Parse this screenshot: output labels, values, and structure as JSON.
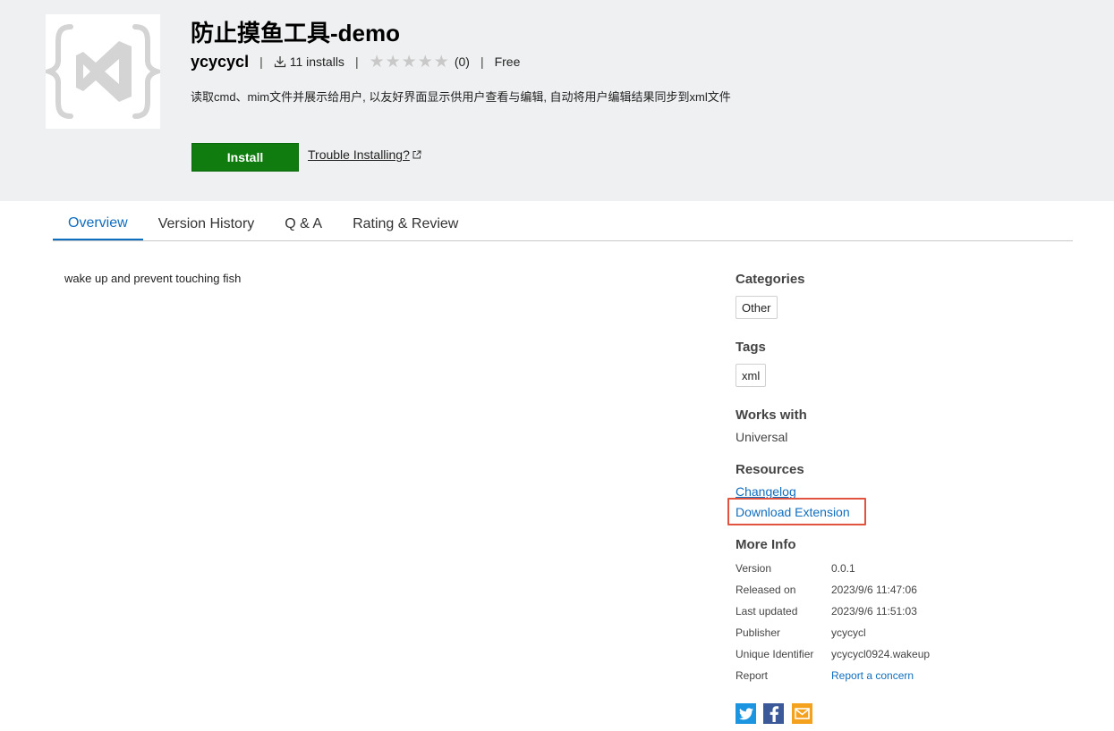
{
  "header": {
    "title": "防止摸鱼工具-demo",
    "publisher": "ycycycl",
    "installs": "11 installs",
    "rating_count": "(0)",
    "price": "Free",
    "description": "读取cmd、mim文件并展示给用户, 以友好界面显示供用户查看与编辑, 自动将用户编辑结果同步到xml文件",
    "install_label": "Install",
    "trouble_label": "Trouble Installing?",
    "stars": 0
  },
  "tabs": [
    {
      "label": "Overview"
    },
    {
      "label": "Version History"
    },
    {
      "label": "Q & A"
    },
    {
      "label": "Rating & Review"
    }
  ],
  "overview": {
    "text": "wake up and prevent touching fish"
  },
  "sidebar": {
    "categories_heading": "Categories",
    "categories": [
      "Other"
    ],
    "tags_heading": "Tags",
    "tags": [
      "xml"
    ],
    "works_with_heading": "Works with",
    "works_with": "Universal",
    "resources_heading": "Resources",
    "changelog": "Changelog",
    "download": "Download Extension",
    "more_info_heading": "More Info",
    "info": [
      {
        "label": "Version",
        "value": "0.0.1"
      },
      {
        "label": "Released on",
        "value": "2023/9/6 11:47:06"
      },
      {
        "label": "Last updated",
        "value": "2023/9/6 11:51:03"
      },
      {
        "label": "Publisher",
        "value": "ycycycl"
      },
      {
        "label": "Unique Identifier",
        "value": "ycycycl0924.wakeup"
      },
      {
        "label": "Report",
        "value": "Report a concern"
      }
    ]
  },
  "colors": {
    "accent": "#106ebe",
    "install": "#107c10",
    "highlight": "#e2533f",
    "header_bg": "#eff0f1"
  },
  "icons": [
    "extension-logo-icon",
    "download-icon",
    "star-icon",
    "external-link-icon",
    "twitter-icon",
    "facebook-icon",
    "email-icon"
  ]
}
